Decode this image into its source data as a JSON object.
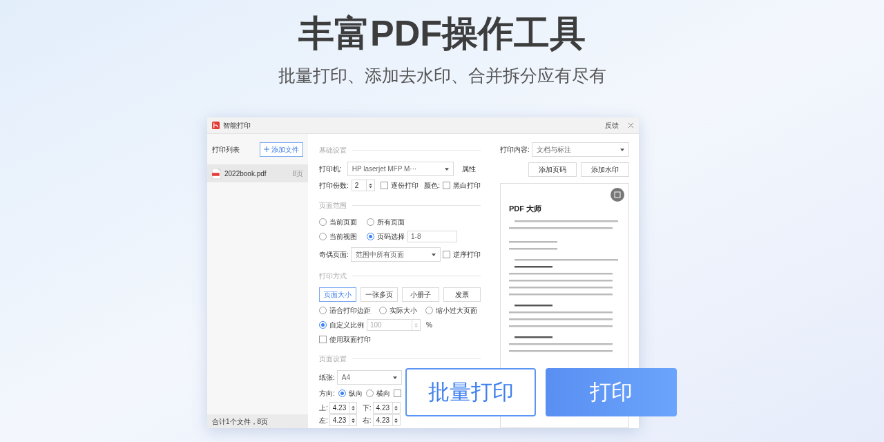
{
  "headline": "丰富PDF操作工具",
  "subheadline": "批量打印、添加去水印、合并拆分应有尽有",
  "dialog": {
    "title": "智能打印",
    "feedback": "反馈",
    "left": {
      "heading": "打印列表",
      "add_button": "添加文件",
      "files": [
        {
          "name": "2022book.pdf",
          "pages": "8页",
          "selected": true
        }
      ],
      "footer": "合计1个文件，8页"
    },
    "basic": {
      "section": "基础设置",
      "printer_label": "打印机:",
      "printer_value": "HP laserjet MFP M···",
      "properties": "属性",
      "copies_label": "打印份数:",
      "copies_value": "2",
      "collate": {
        "label": "逐份打印",
        "checked": false
      },
      "color_label": "颜色:",
      "bw": {
        "label": "黑白打印",
        "checked": false
      }
    },
    "range": {
      "section": "页面范围",
      "options": [
        {
          "label": "当前页面",
          "selected": false
        },
        {
          "label": "所有页面",
          "selected": false
        },
        {
          "label": "当前视图",
          "selected": false
        },
        {
          "label": "页码选择",
          "selected": true
        }
      ],
      "page_input": "1-8",
      "parity_label": "奇偶页面:",
      "parity_value": "范围中所有页面",
      "reverse": {
        "label": "逆序打印",
        "checked": false
      }
    },
    "mode": {
      "section": "打印方式",
      "tabs": [
        {
          "label": "页面大小",
          "selected": true
        },
        {
          "label": "一张多页",
          "selected": false
        },
        {
          "label": "小册子",
          "selected": false
        },
        {
          "label": "发票",
          "selected": false
        }
      ],
      "fit_options": [
        {
          "label": "适合打印边距",
          "selected": false
        },
        {
          "label": "实际大小",
          "selected": false
        },
        {
          "label": "缩小过大页面",
          "selected": false
        },
        {
          "label": "自定义比例",
          "selected": true
        }
      ],
      "scale_value": "100",
      "percent": "%",
      "duplex": {
        "label": "使用双面打印",
        "checked": false
      }
    },
    "page_setup": {
      "section": "页面设置",
      "paper_label": "纸张:",
      "paper_value": "A4",
      "orientation_label": "方向:",
      "orientations": [
        {
          "label": "纵向",
          "selected": true
        },
        {
          "label": "横向",
          "selected": false
        }
      ],
      "extra_checkbox": {
        "checked": false
      },
      "margins": [
        {
          "label": "上:",
          "value": "4.23"
        },
        {
          "label": "下:",
          "value": "4.23"
        },
        {
          "label": "左:",
          "value": "4.23"
        },
        {
          "label": "右:",
          "value": "4.23"
        }
      ]
    },
    "right": {
      "content_label": "打印内容:",
      "content_value": "文档与标注",
      "buttons": [
        "添加页码",
        "添加水印"
      ],
      "preview_heading": "PDF 大师"
    }
  },
  "actions": [
    {
      "label": "批量打印",
      "kind": "outline"
    },
    {
      "label": "打印",
      "kind": "primary"
    }
  ]
}
